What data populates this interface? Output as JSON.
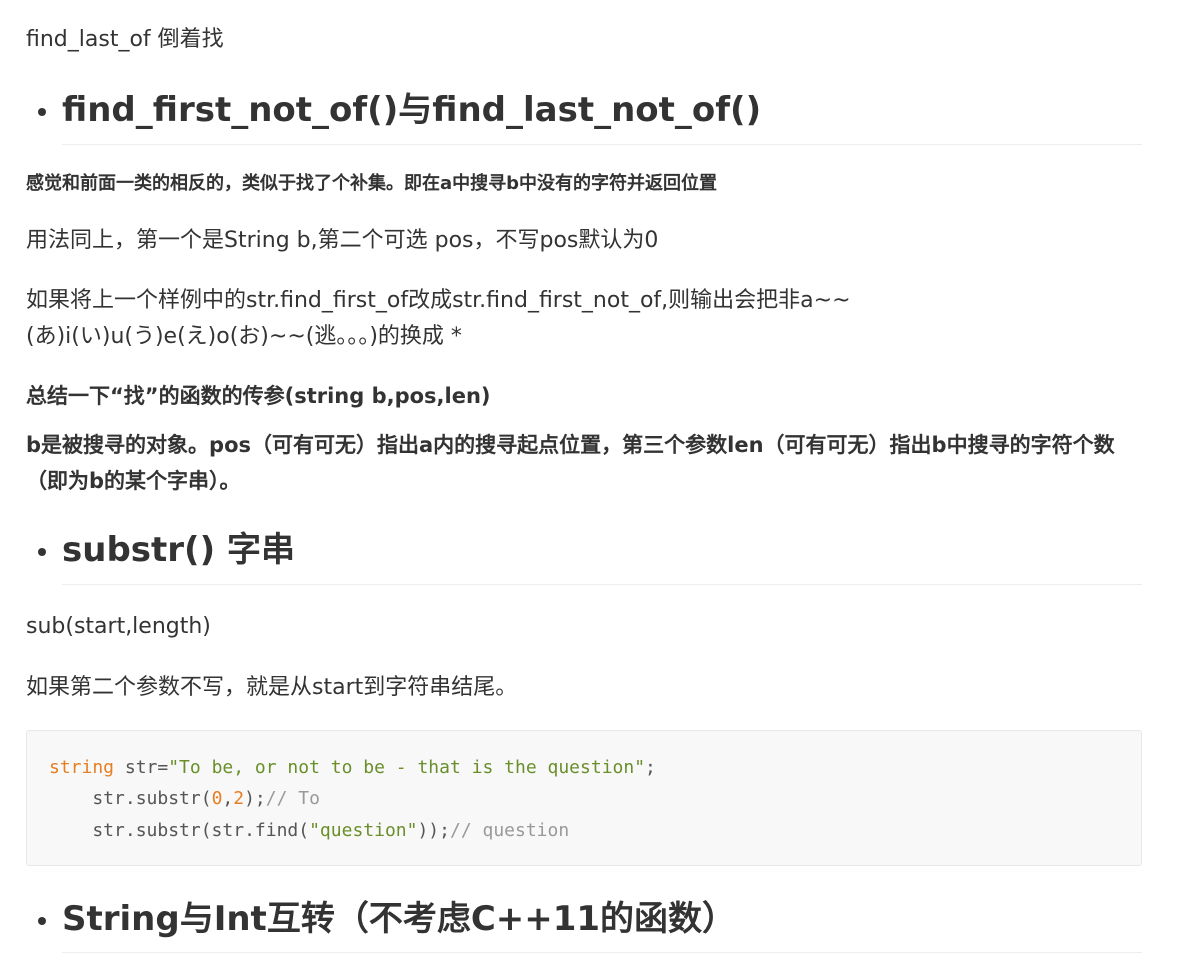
{
  "intro": "find_last_of 倒着找",
  "section1": {
    "heading": "find_first_not_of()与find_last_not_of()",
    "note": "感觉和前面一类的相反的，类似于找了个补集。即在a中搜寻b中没有的字符并返回位置",
    "usage": "用法同上，第一个是String b,第二个可选 pos，不写pos默认为0",
    "example_line1": "如果将上一个样例中的str.find_first_of改成str.find_first_not_of,则输出会把非a~~",
    "example_line2": "(あ)i(い)u(う)e(え)o(お)~~(逃。。。)的换成 *",
    "summary_title": "总结一下“找”的函数的传参(string b,pos,len)",
    "summary_body": "b是被搜寻的对象。pos（可有可无）指出a内的搜寻起点位置，第三个参数len（可有可无）指出b中搜寻的字符个数（即为b的某个字串）。"
  },
  "section2": {
    "heading": "substr() 字串",
    "signature": "sub(start,length)",
    "note": "如果第二个参数不写，就是从start到字符串结尾。",
    "code": {
      "line1": {
        "keyword": "string",
        "ident": " str=",
        "literal": "\"To be, or not to be - that is the question\"",
        "end": ";"
      },
      "line2": {
        "indent": "    str.substr(",
        "num1": "0",
        "comma": ",",
        "num2": "2",
        "close": ");",
        "comment": "// To"
      },
      "line3": {
        "indent": "    str.substr(str.find(",
        "literal": "\"question\"",
        "close": "));",
        "comment": "// question"
      }
    }
  },
  "section3": {
    "heading": "String与Int互转（不考虑C++11的函数）"
  }
}
